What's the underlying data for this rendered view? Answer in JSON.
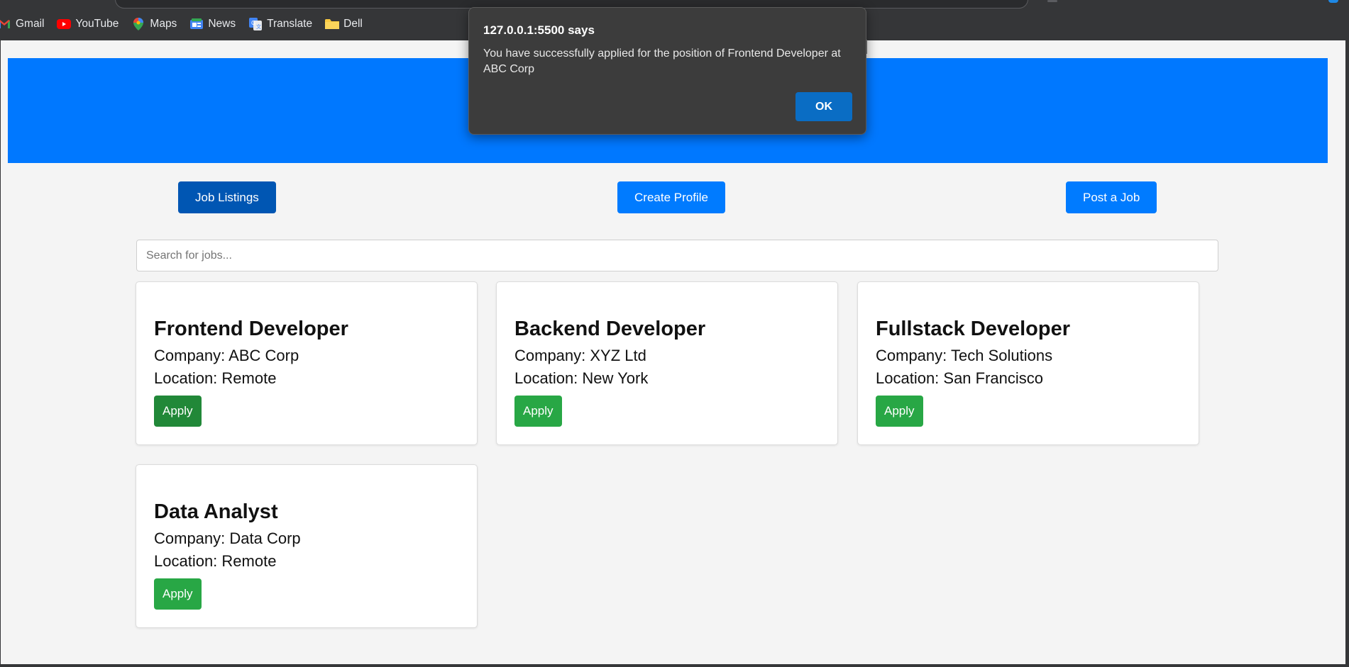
{
  "bookmarks": [
    {
      "label": "Gmail",
      "icon": "gmail-icon"
    },
    {
      "label": "YouTube",
      "icon": "youtube-icon"
    },
    {
      "label": "Maps",
      "icon": "maps-icon"
    },
    {
      "label": "News",
      "icon": "news-icon"
    },
    {
      "label": "Translate",
      "icon": "translate-icon"
    },
    {
      "label": "Dell",
      "icon": "folder-icon"
    }
  ],
  "nav": {
    "job_listings": "Job Listings",
    "create_profile": "Create Profile",
    "post_job": "Post a Job"
  },
  "search": {
    "placeholder": "Search for jobs...",
    "value": ""
  },
  "jobs": [
    {
      "title": "Frontend Developer",
      "company": "Company: ABC Corp",
      "location": "Location: Remote",
      "apply_label": "Apply"
    },
    {
      "title": "Backend Developer",
      "company": "Company: XYZ Ltd",
      "location": "Location: New York",
      "apply_label": "Apply"
    },
    {
      "title": "Fullstack Developer",
      "company": "Company: Tech Solutions",
      "location": "Location: San Francisco",
      "apply_label": "Apply"
    },
    {
      "title": "Data Analyst",
      "company": "Company: Data Corp",
      "location": "Location: Remote",
      "apply_label": "Apply"
    }
  ],
  "dialog": {
    "title": "127.0.0.1:5500 says",
    "message": "You have successfully applied for the position of Frontend Developer at ABC Corp",
    "ok_label": "OK"
  },
  "colors": {
    "header": "#0078ff",
    "nav_button": "#007bff",
    "nav_button_active": "#0056b3",
    "apply_button": "#28a745",
    "dialog_bg": "#3c3c3c",
    "dialog_ok": "#0a6dc4"
  }
}
